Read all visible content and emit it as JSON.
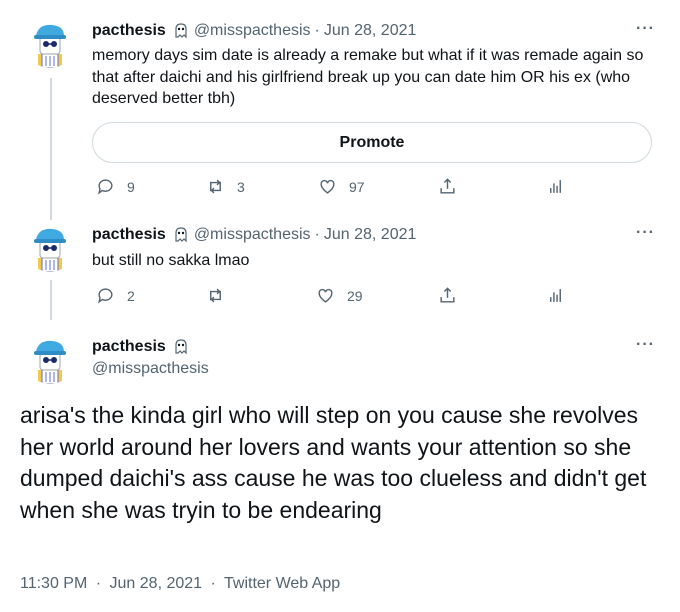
{
  "tweets": [
    {
      "name": "pacthesis",
      "handle": "@misspacthesis",
      "date": "Jun 28, 2021",
      "text": "memory days sim date is already a remake but what if it was remade again so that after daichi and his girlfriend break up you can date him OR his ex (who deserved better tbh)",
      "promote_label": "Promote",
      "replies": "9",
      "retweets": "3",
      "likes": "97"
    },
    {
      "name": "pacthesis",
      "handle": "@misspacthesis",
      "date": "Jun 28, 2021",
      "text": "but still no sakka lmao",
      "replies": "2",
      "retweets": "",
      "likes": "29"
    }
  ],
  "main_tweet": {
    "name": "pacthesis",
    "handle": "@misspacthesis",
    "text": "arisa's the kinda girl who will step on you cause she revolves her world around her lovers and wants your attention so she dumped daichi's ass cause he was too clueless and didn't get when she was tryin to be endearing",
    "time": "11:30 PM",
    "date": "Jun 28, 2021",
    "source": "Twitter Web App"
  },
  "separator": "·",
  "more_label": "···",
  "colors": {
    "text": "#0f1419",
    "secondary": "#536471",
    "border": "#cfd9de",
    "avatar_hat": "#3fa9e0",
    "avatar_shirt": "#f2c94c"
  },
  "icons": [
    "ghost-emoji-icon",
    "reply-icon",
    "retweet-icon",
    "like-icon",
    "share-icon",
    "analytics-icon",
    "more-icon"
  ]
}
